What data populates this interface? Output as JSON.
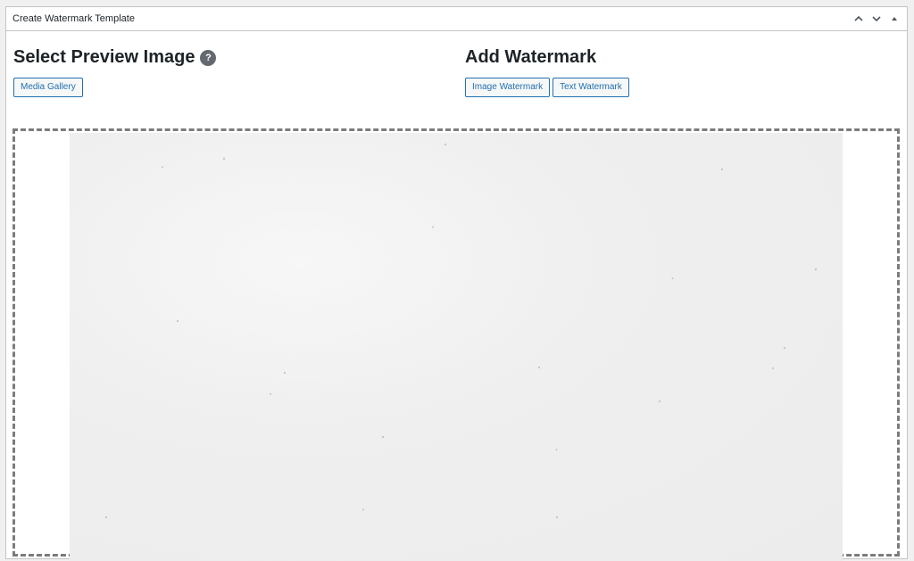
{
  "metabox": {
    "title": "Create Watermark Template",
    "controls": {
      "move_up_icon": "chevron-up-icon",
      "move_down_icon": "chevron-down-icon",
      "toggle_icon": "caret-up-icon"
    }
  },
  "preview": {
    "heading": "Select Preview Image",
    "help_icon_text": "?",
    "media_gallery_label": "Media Gallery"
  },
  "watermark": {
    "heading": "Add Watermark",
    "image_watermark_label": "Image Watermark",
    "text_watermark_label": "Text Watermark"
  },
  "colors": {
    "accent": "#2271b1",
    "border": "#c3c4c7",
    "dashed_border": "#7c7c7c",
    "help_icon_bg": "#646970"
  }
}
